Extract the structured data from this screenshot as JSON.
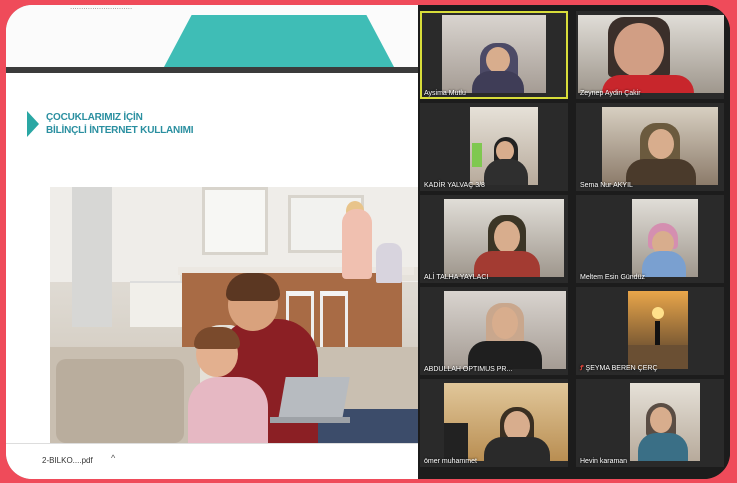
{
  "browser": {
    "url_fragment": "............................"
  },
  "slide": {
    "title_line1": "ÇOCUKLARIMIZ İÇİN",
    "title_line2": "BİLİNÇLİ İNTERNET KULLANIMI"
  },
  "download_bar": {
    "file_name": "2-BILKO....pdf",
    "chevron": "^"
  },
  "participants": [
    {
      "name": "Aysima Mutlu",
      "active": true
    },
    {
      "name": "Zeynep Aydin Çakir"
    },
    {
      "name": "KADİR YALVAÇ 3/8"
    },
    {
      "name": "Sema Nur AKYIL"
    },
    {
      "name": "ALİ TALHA YAYLACI"
    },
    {
      "name": "Meltem Esin Gündüz"
    },
    {
      "name": "ABDULLAH OPTIMUS PR..."
    },
    {
      "name": "ŞEYMA BEREN ÇERÇ",
      "muted_icon": "mic-muted-icon",
      "muted_glyph": "Ꝭ"
    },
    {
      "name": "ömer muhammet"
    },
    {
      "name": "Hevin karaman"
    }
  ],
  "colors": {
    "outer_background": "#ef4b5a",
    "active_speaker_border": "#d8dd3a",
    "slide_accent": "#3fbdb6"
  }
}
